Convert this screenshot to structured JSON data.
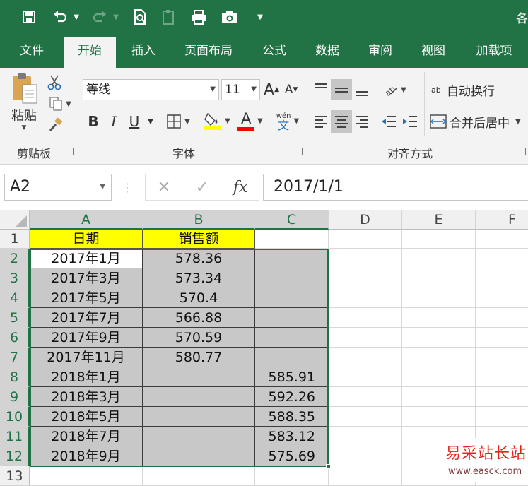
{
  "app": {
    "title_partial": "各"
  },
  "quick_access": {
    "save_icon": "save-icon",
    "undo_icon": "undo-icon",
    "redo_icon": "redo-icon",
    "print_preview_icon": "print-preview-icon",
    "clipboard_icon": "clipboard-icon",
    "print_icon": "print-icon",
    "camera_icon": "camera-icon",
    "customize_icon": "customize-icon"
  },
  "tabs": [
    "文件",
    "开始",
    "插入",
    "页面布局",
    "公式",
    "数据",
    "审阅",
    "视图",
    "加载项"
  ],
  "active_tab": "开始",
  "ribbon": {
    "clipboard": {
      "paste_label": "粘贴",
      "group_label": "剪贴板"
    },
    "font": {
      "font_name": "等线",
      "font_size": "11",
      "grow_label": "A",
      "shrink_label": "A",
      "bold_label": "B",
      "italic_label": "I",
      "underline_label": "U",
      "font_color_label": "A",
      "phonetic_top": "wén",
      "phonetic_bottom": "文",
      "group_label": "字体"
    },
    "alignment": {
      "wrap_text_label": "自动换行",
      "merge_center_label": "合并后居中",
      "wrap_prefix": "ab",
      "group_label": "对齐方式"
    },
    "colors": {
      "highlight": "#ffff00",
      "font_color": "#ff0000",
      "accent": "#217346"
    }
  },
  "formula_bar": {
    "name_box": "A2",
    "cancel_symbol": "✕",
    "enter_symbol": "✓",
    "fx_label": "fx",
    "formula": "2017/1/1"
  },
  "sheet": {
    "columns": [
      "A",
      "B",
      "C",
      "D",
      "E",
      "F"
    ],
    "rows": [
      "1",
      "2",
      "3",
      "4",
      "5",
      "6",
      "7",
      "8",
      "9",
      "10",
      "11",
      "12",
      "13"
    ],
    "headers": [
      "日期",
      "销售额",
      ""
    ],
    "data": [
      [
        "2017年1月",
        "578.36",
        ""
      ],
      [
        "2017年3月",
        "573.34",
        ""
      ],
      [
        "2017年5月",
        "570.4",
        ""
      ],
      [
        "2017年7月",
        "566.88",
        ""
      ],
      [
        "2017年9月",
        "570.59",
        ""
      ],
      [
        "2017年11月",
        "580.77",
        ""
      ],
      [
        "2018年1月",
        "",
        "585.91"
      ],
      [
        "2018年3月",
        "",
        "592.26"
      ],
      [
        "2018年5月",
        "",
        "588.35"
      ],
      [
        "2018年7月",
        "",
        "583.12"
      ],
      [
        "2018年9月",
        "",
        "575.69"
      ]
    ]
  },
  "watermark": {
    "text": "易采站长站",
    "url": "www.easck.com"
  }
}
